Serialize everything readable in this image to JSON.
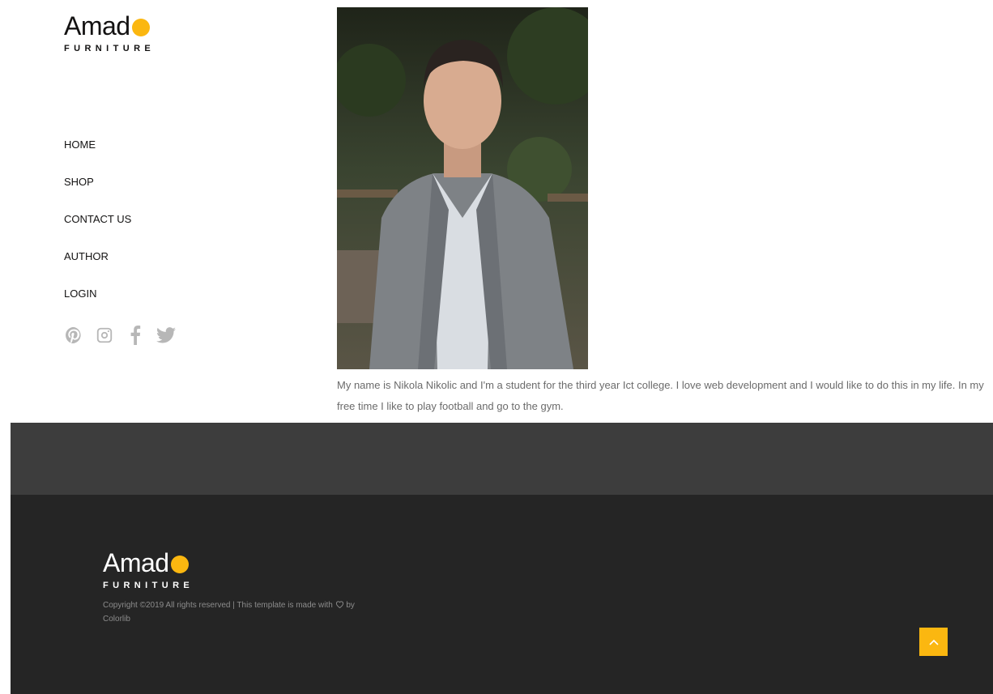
{
  "brand": {
    "name": "Amad",
    "tagline": "FURNITURE"
  },
  "nav": {
    "items": [
      {
        "label": "HOME"
      },
      {
        "label": "SHOP"
      },
      {
        "label": "CONTACT US"
      },
      {
        "label": "AUTHOR"
      },
      {
        "label": "LOGIN"
      }
    ]
  },
  "social": {
    "icons": [
      "pinterest-icon",
      "instagram-icon",
      "facebook-icon",
      "twitter-icon"
    ]
  },
  "author": {
    "bio": "My name is Nikola Nikolic and I'm a student for the third year Ict college. I love web development and I would like to do this in my life. In my free time I like to play football and go to the gym."
  },
  "footer": {
    "brand": "Amad",
    "tagline": "FURNITURE",
    "copyright_prefix": "Copyright ©2019 All rights reserved | This template is made with",
    "copyright_suffix": "by Colorlib"
  },
  "colors": {
    "accent": "#fbb710",
    "footer_dark": "#252525",
    "footer_band": "#3d3d3d"
  }
}
